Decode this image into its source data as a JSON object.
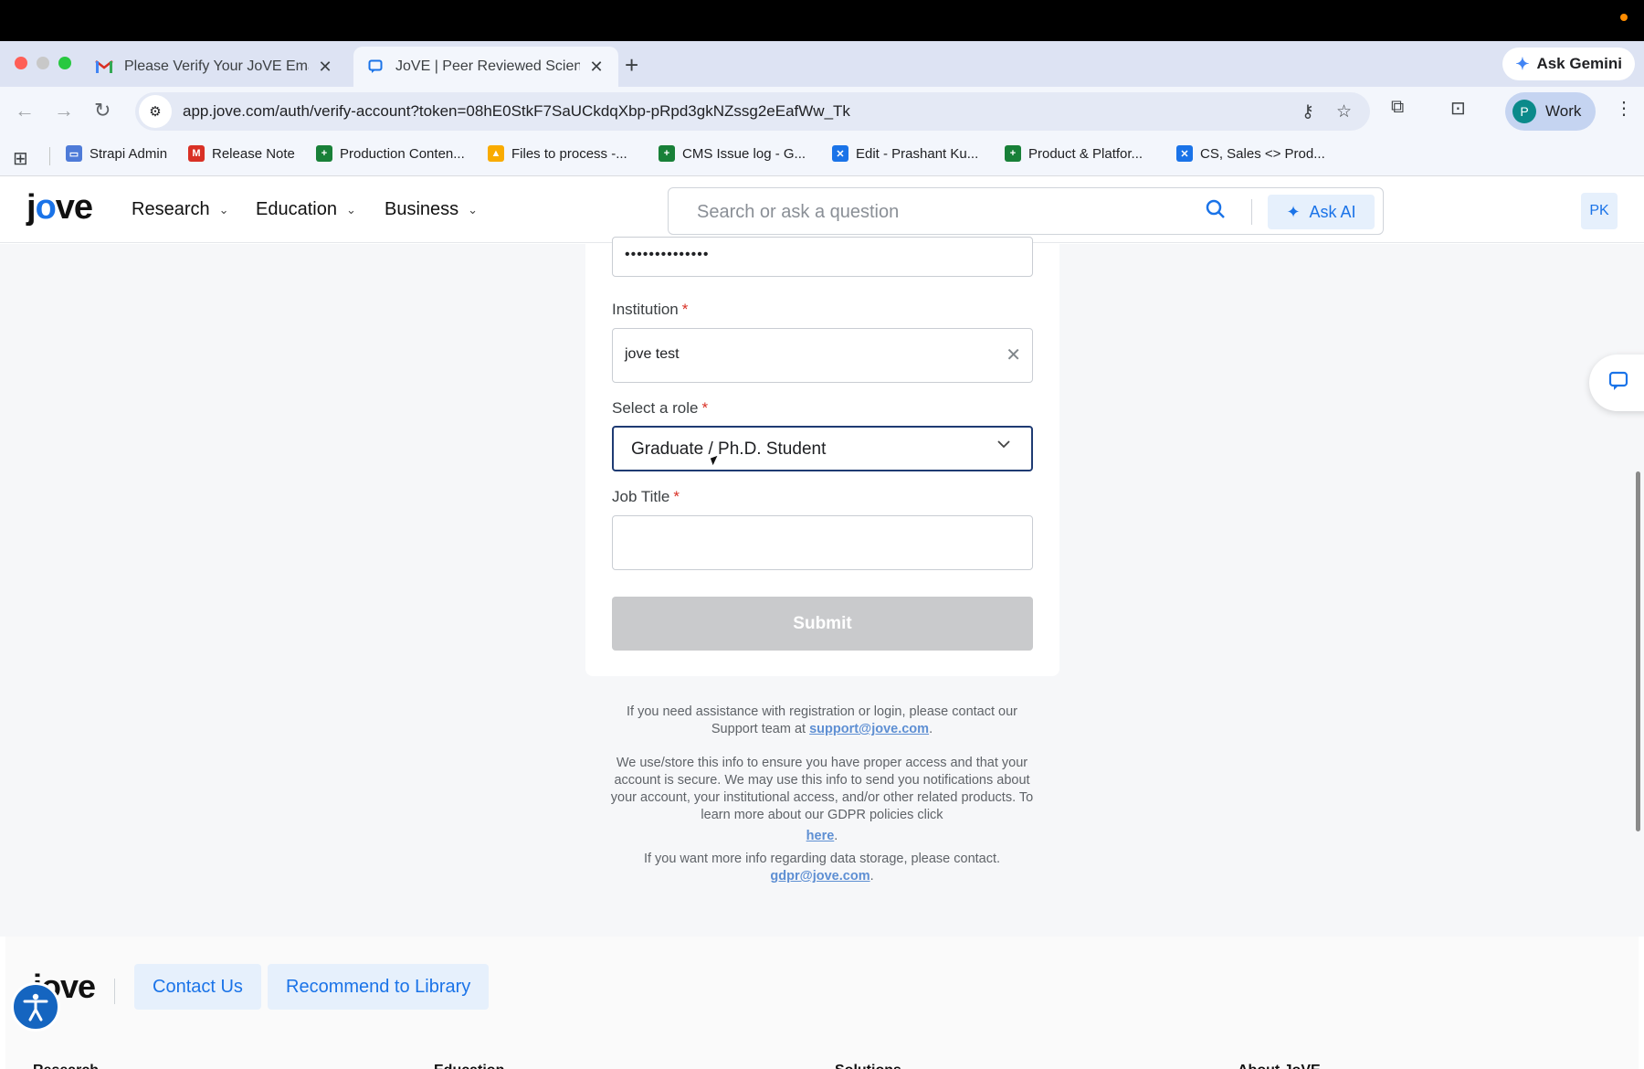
{
  "browser": {
    "tabs": [
      {
        "title": "Please Verify Your JoVE Email",
        "favicon": "gmail-icon",
        "active": false
      },
      {
        "title": "JoVE | Peer Reviewed Scientific",
        "favicon": "chat-bubble-icon",
        "active": true
      }
    ],
    "new_tab": "+",
    "ask_gemini": "Ask Gemini",
    "url": "app.jove.com/auth/verify-account?token=08hE0StkF7SaUCkdqXbp-pRpd3gkNZssg2eEafWw_Tk",
    "profile_initial": "P",
    "profile_name": "Work",
    "bookmarks": [
      {
        "label": "Strapi Admin",
        "color": "#4e7bd8"
      },
      {
        "label": "Release Note",
        "color": "#d93025"
      },
      {
        "label": "Production Conten...",
        "color": "#188038"
      },
      {
        "label": "Files to process -...",
        "color": "#f9ab00"
      },
      {
        "label": "CMS Issue log - G...",
        "color": "#188038"
      },
      {
        "label": "Edit - Prashant Ku...",
        "color": "#1a73e8"
      },
      {
        "label": "Product & Platfor...",
        "color": "#188038"
      },
      {
        "label": "CS, Sales <> Prod...",
        "color": "#1a73e8"
      }
    ]
  },
  "site": {
    "logo": "jove",
    "nav": [
      "Research",
      "Education",
      "Business"
    ],
    "search_placeholder": "Search or ask a question",
    "ask_ai": "Ask AI",
    "user_initials": "PK"
  },
  "form": {
    "password_mask": "••••••••••••••",
    "institution_label": "Institution",
    "institution_value": "jove test",
    "role_label": "Select a role",
    "role_value": "Graduate / Ph.D. Student",
    "job_title_label": "Job Title",
    "job_title_value": "",
    "required_mark": "*",
    "submit": "Submit"
  },
  "info": {
    "support_pre": "If you need assistance with registration or login, please contact our Support team at",
    "support_link": "support@jove.com",
    "gdpr_text": "We use/store this info to ensure you have proper access and that your account is secure. We may use this info to send you notifications about your account, your institutional access, and/or other related products. To learn more about our GDPR policies click",
    "gdpr_link": "here",
    "storage_text": "If you want more info regarding data storage, please contact.",
    "storage_link": "gdpr@jove.com",
    "period": "."
  },
  "footer": {
    "logo": "jove",
    "contact": "Contact Us",
    "recommend": "Recommend to Library",
    "columns": [
      "Research",
      "Education",
      "Solutions",
      "About JoVE"
    ]
  },
  "colors": {
    "accent": "#1a73e8",
    "select_border": "#1f3b73",
    "submit_disabled": "#c9cacc",
    "required": "#d93025"
  }
}
